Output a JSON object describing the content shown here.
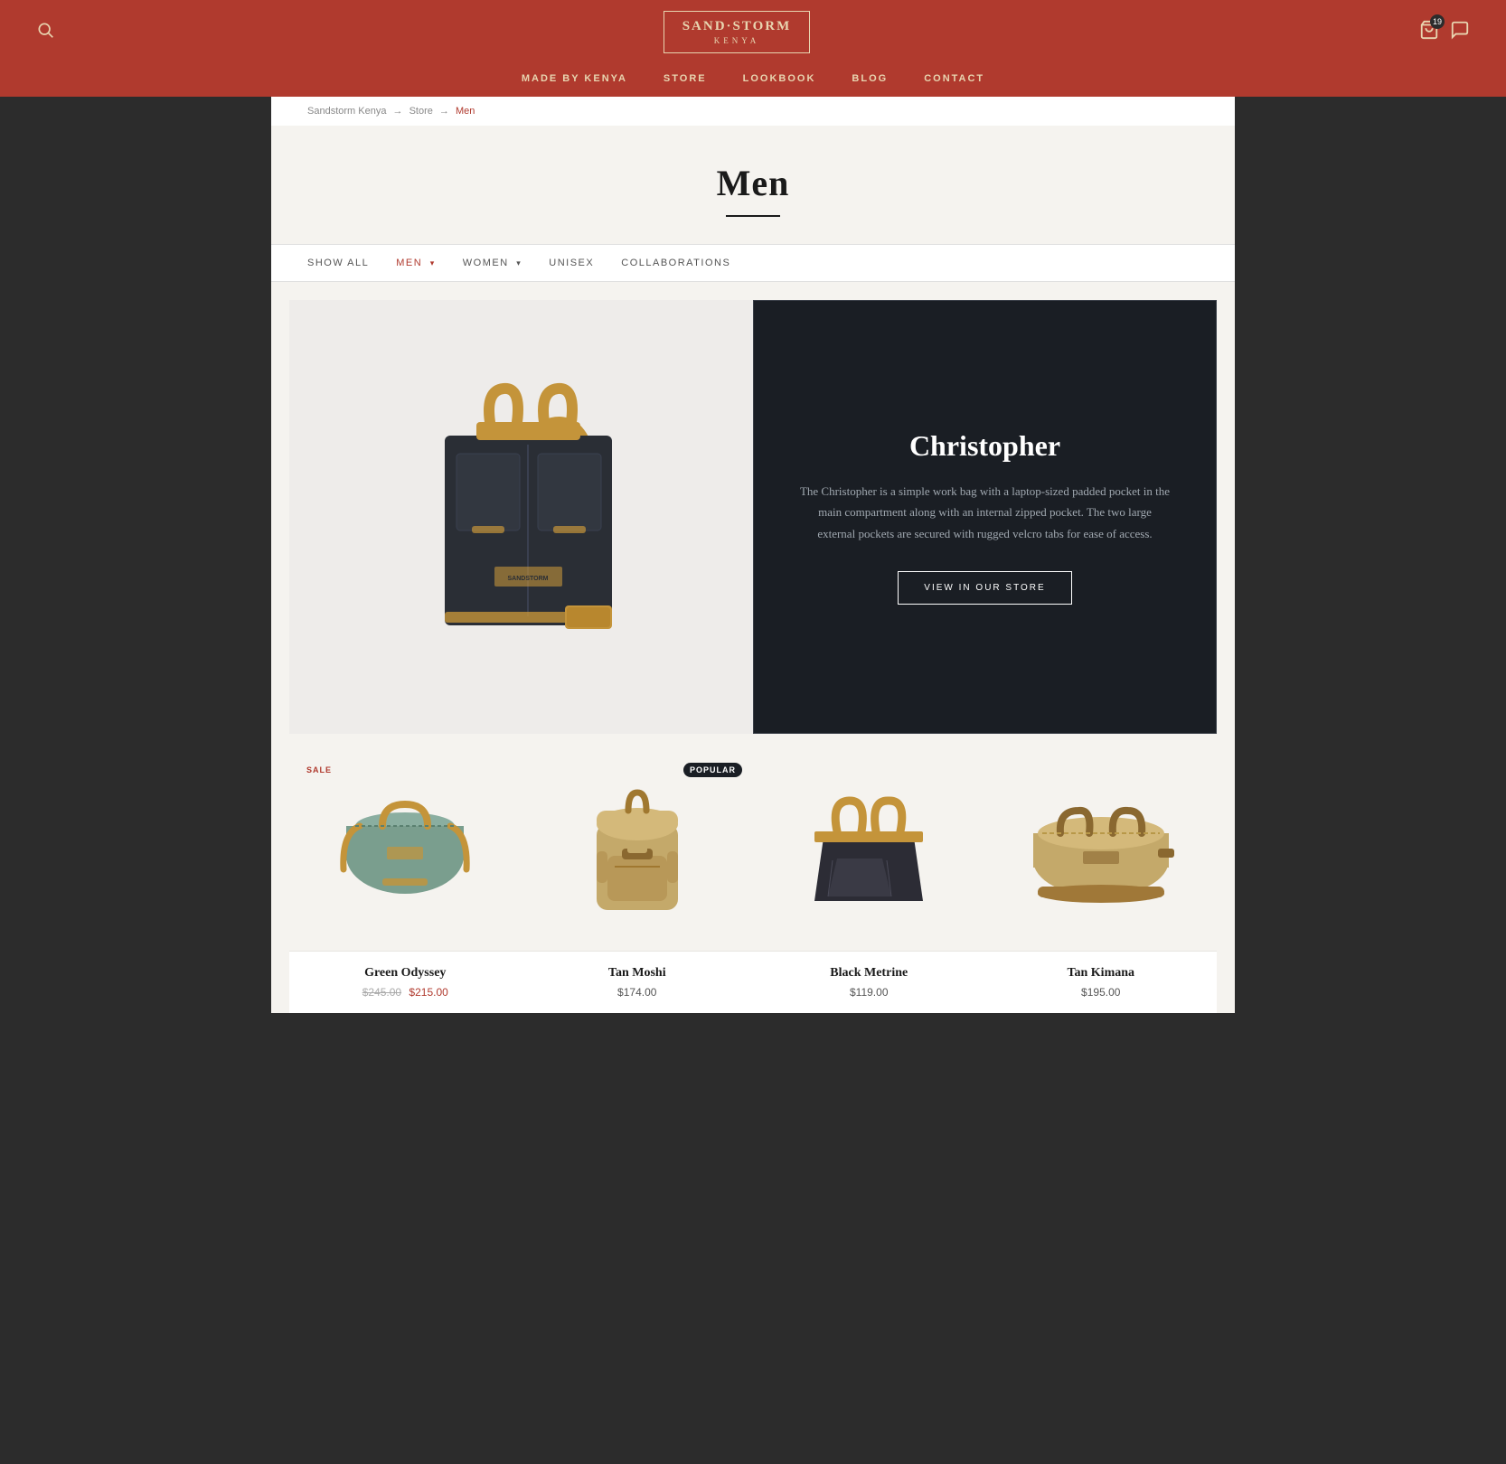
{
  "header": {
    "logo_line1": "SAND·STORM",
    "logo_line2": "KENYA",
    "cart_count": "19",
    "nav": [
      {
        "label": "MADE BY KENYA",
        "key": "made-by-kenya"
      },
      {
        "label": "STORE",
        "key": "store"
      },
      {
        "label": "LOOKBOOK",
        "key": "lookbook"
      },
      {
        "label": "BLOG",
        "key": "blog"
      },
      {
        "label": "CONTACT",
        "key": "contact"
      }
    ]
  },
  "breadcrumb": {
    "items": [
      {
        "label": "Sandstorm Kenya",
        "href": "#"
      },
      {
        "label": "Store",
        "href": "#"
      },
      {
        "label": "Men",
        "current": true
      }
    ]
  },
  "page": {
    "title": "Men"
  },
  "filters": [
    {
      "label": "SHOW ALL",
      "key": "show-all",
      "active": false
    },
    {
      "label": "MEN",
      "key": "men",
      "active": true,
      "hasChevron": true
    },
    {
      "label": "WOMEN",
      "key": "women",
      "active": false,
      "hasChevron": true
    },
    {
      "label": "UNISEX",
      "key": "unisex",
      "active": false
    },
    {
      "label": "COLLABORATIONS",
      "key": "collaborations",
      "active": false
    }
  ],
  "featured": {
    "title": "Christopher",
    "description": "The Christopher is a simple work bag with a laptop-sized padded pocket in the main compartment along with an internal zipped pocket. The two large external pockets are secured with rugged velcro tabs for ease of access.",
    "button_label": "VIEW IN OUR STORE"
  },
  "products": [
    {
      "name": "Green Odyssey",
      "price_original": "$245.00",
      "price_sale": "$215.00",
      "badge": "SALE",
      "badge_type": "sale",
      "color": "#7a9e8e"
    },
    {
      "name": "Tan Moshi",
      "price": "$174.00",
      "badge": "POPULAR",
      "badge_type": "popular",
      "color": "#c4a96a"
    },
    {
      "name": "Black Metrine",
      "price": "$119.00",
      "badge": null,
      "color": "#2c2c2c"
    },
    {
      "name": "Tan Kimana",
      "price": "$195.00",
      "badge": null,
      "color": "#c4a96a"
    }
  ]
}
